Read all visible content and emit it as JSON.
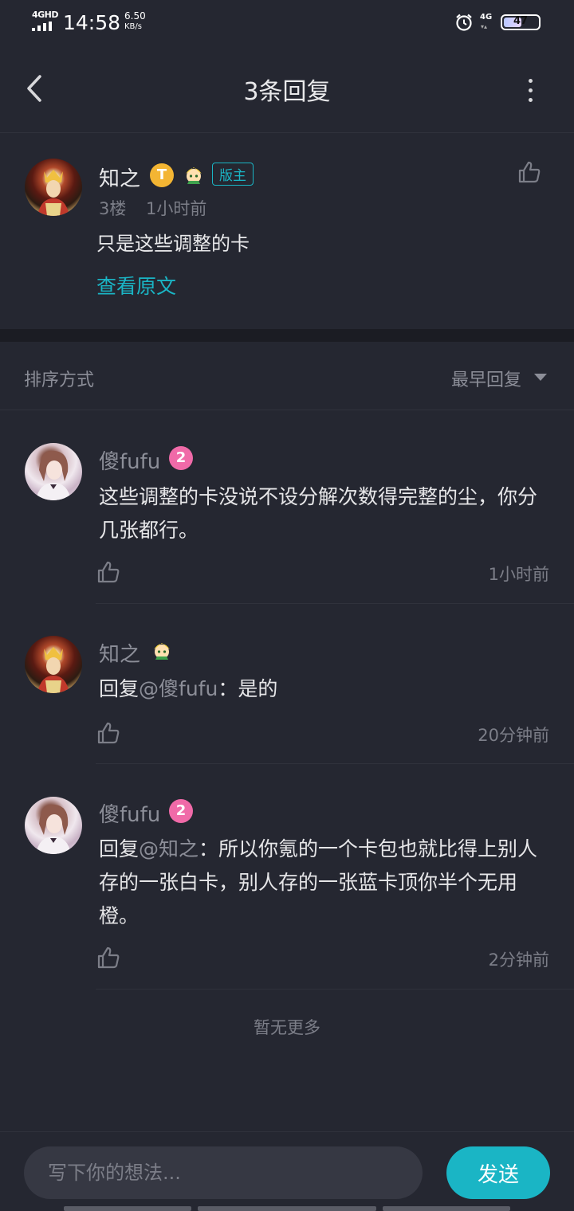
{
  "status_bar": {
    "network": "4GHD",
    "time": "14:58",
    "speed_value": "6.50",
    "speed_unit": "KB/s",
    "cell": "4G",
    "battery": "47"
  },
  "header": {
    "title": "3条回复"
  },
  "main_post": {
    "author": "知之",
    "badge_t": "T",
    "mod_badge": "版主",
    "floor": "3楼",
    "time": "1小时前",
    "text": "只是这些调整的卡",
    "view_original": "查看原文"
  },
  "sort": {
    "label": "排序方式",
    "selected": "最早回复"
  },
  "replies": [
    {
      "author": "傻fufu",
      "level": "2",
      "text": "这些调整的卡没说不设分解次数得完整的尘，你分几张都行。",
      "time": "1小时前"
    },
    {
      "author": "知之",
      "prefix": "回复",
      "mention": "@傻fufu",
      "text": "：是的",
      "time": "20分钟前"
    },
    {
      "author": "傻fufu",
      "level": "2",
      "prefix": "回复",
      "mention": "@知之",
      "text": "：所以你氪的一个卡包也就比得上别人存的一张白卡，别人存的一张蓝卡顶你半个无用橙。",
      "time": "2分钟前"
    }
  ],
  "footer": {
    "no_more": "暂无更多"
  },
  "input": {
    "placeholder": "写下你的想法...",
    "send_label": "发送"
  },
  "colors": {
    "background": "#252731",
    "accent": "#1ab5c5",
    "muted_text": "#8c8e98",
    "level_badge": "#f06aa8",
    "t_badge": "#f3b533"
  }
}
